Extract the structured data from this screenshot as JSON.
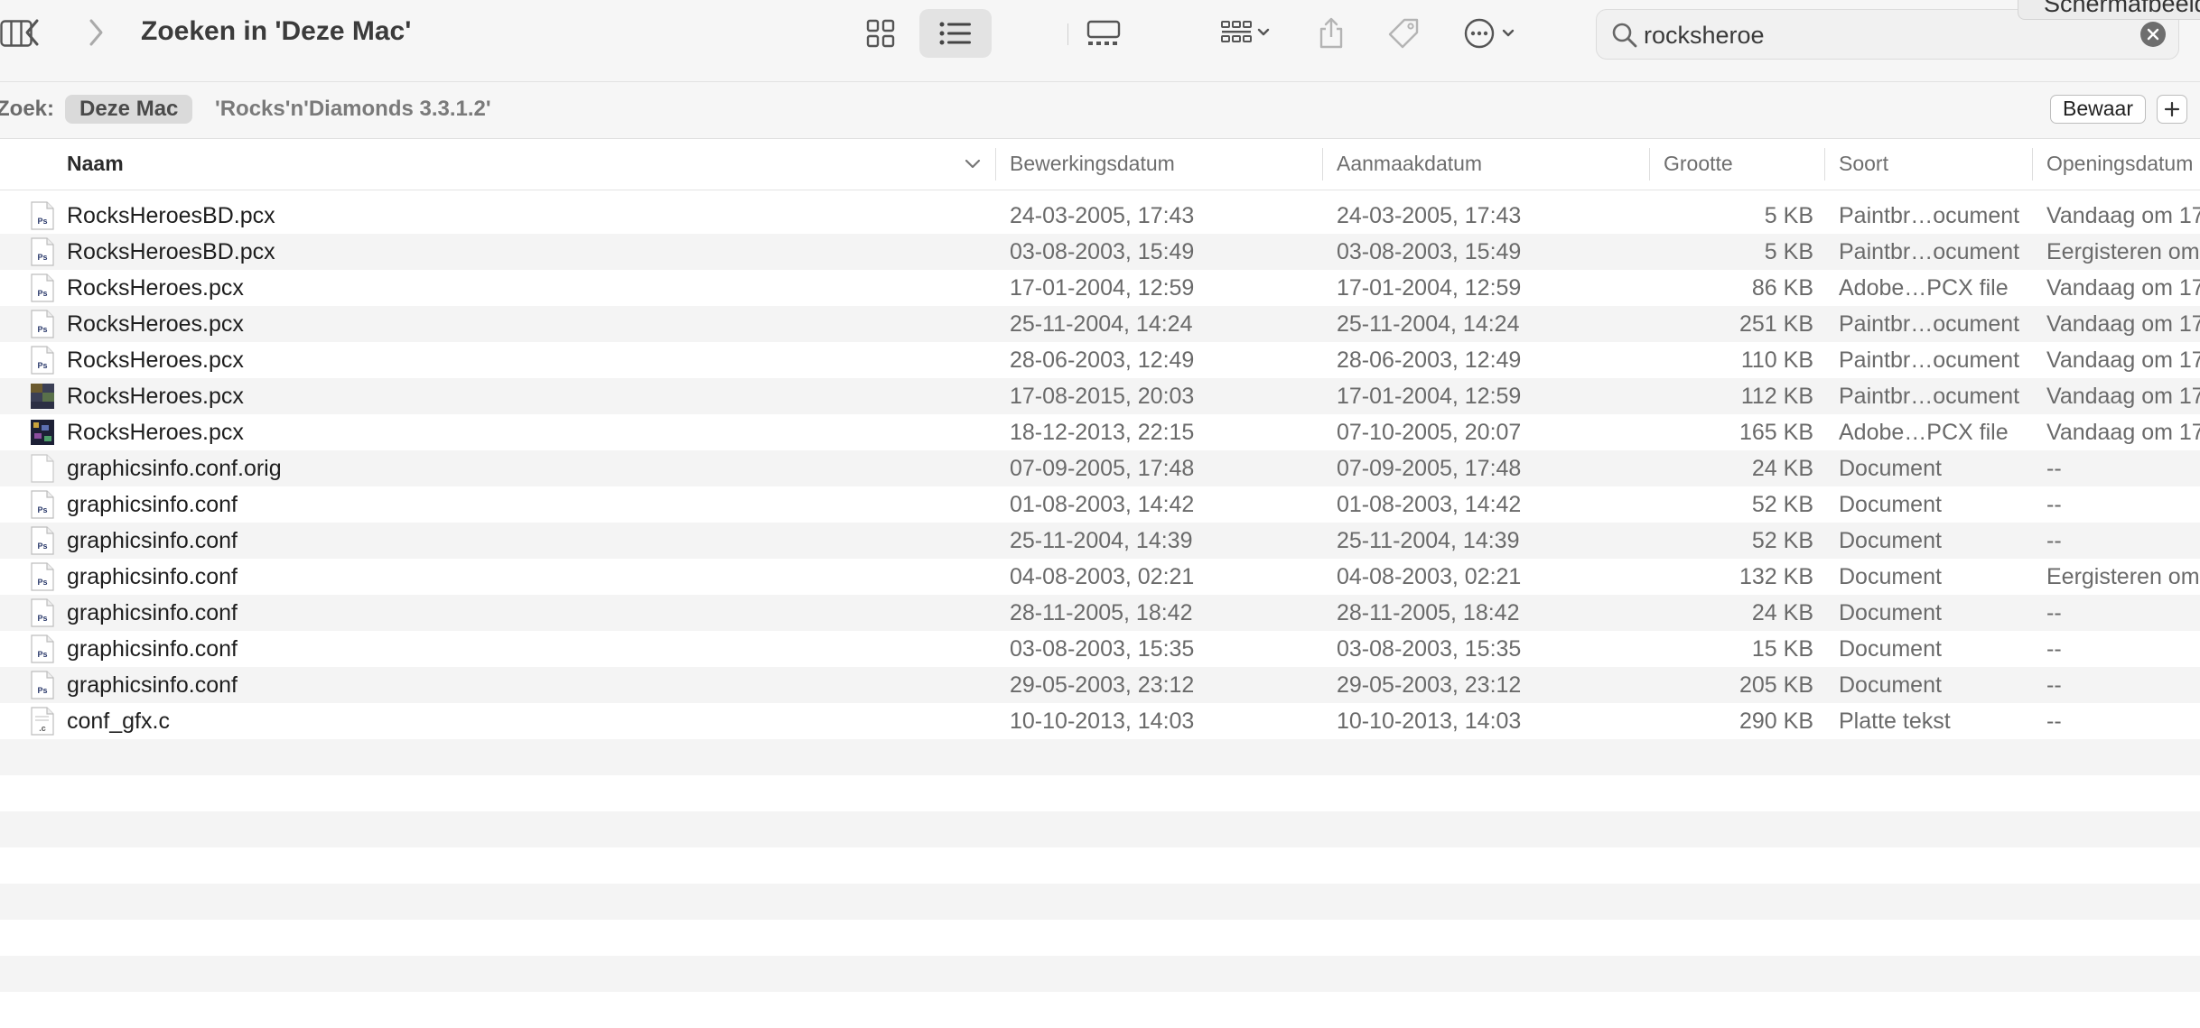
{
  "window": {
    "title": "Zoeken in 'Deze Mac'",
    "popup_text": "Schermafbeelding"
  },
  "toolbar": {
    "back_icon": "chevron-left-icon",
    "forward_icon": "chevron-right-icon",
    "view_modes": [
      "icon-view",
      "list-view",
      "column-view",
      "gallery-view"
    ],
    "active_view": "list-view",
    "group_icon": "group-grid-icon",
    "share_icon": "share-icon",
    "tag_icon": "tag-icon",
    "more_icon": "ellipsis-circle-icon"
  },
  "search": {
    "value": "rocksheroe",
    "icon": "magnifier-icon",
    "clear_icon": "clear-x-icon"
  },
  "scope": {
    "label": "Zoek:",
    "active": "Deze Mac",
    "other": "'Rocks'n'Diamonds 3.3.1.2'",
    "save_label": "Bewaar",
    "add_label": "+"
  },
  "columns": {
    "name": "Naam",
    "modified": "Bewerkingsdatum",
    "created": "Aanmaakdatum",
    "size": "Grootte",
    "kind": "Soort",
    "opened": "Openingsdatum"
  },
  "files": [
    {
      "name": "RocksHeroesBD.pcx",
      "modified": "24-03-2005, 17:43",
      "created": "24-03-2005, 17:43",
      "size": "5 KB",
      "kind": "Paintbr…ocument",
      "opened": "Vandaag om 17",
      "icon": "ps"
    },
    {
      "name": "RocksHeroesBD.pcx",
      "modified": "03-08-2003, 15:49",
      "created": "03-08-2003, 15:49",
      "size": "5 KB",
      "kind": "Paintbr…ocument",
      "opened": "Eergisteren om",
      "icon": "ps"
    },
    {
      "name": "RocksHeroes.pcx",
      "modified": "17-01-2004, 12:59",
      "created": "17-01-2004, 12:59",
      "size": "86 KB",
      "kind": "Adobe…PCX file",
      "opened": "Vandaag om 17",
      "icon": "ps"
    },
    {
      "name": "RocksHeroes.pcx",
      "modified": "25-11-2004, 14:24",
      "created": "25-11-2004, 14:24",
      "size": "251 KB",
      "kind": "Paintbr…ocument",
      "opened": "Vandaag om 17",
      "icon": "ps"
    },
    {
      "name": "RocksHeroes.pcx",
      "modified": "28-06-2003, 12:49",
      "created": "28-06-2003, 12:49",
      "size": "110 KB",
      "kind": "Paintbr…ocument",
      "opened": "Vandaag om 17",
      "icon": "ps"
    },
    {
      "name": "RocksHeroes.pcx",
      "modified": "17-08-2015, 20:03",
      "created": "17-01-2004, 12:59",
      "size": "112 KB",
      "kind": "Paintbr…ocument",
      "opened": "Vandaag om 17",
      "icon": "thumb"
    },
    {
      "name": "RocksHeroes.pcx",
      "modified": "18-12-2013, 22:15",
      "created": "07-10-2005, 20:07",
      "size": "165 KB",
      "kind": "Adobe…PCX file",
      "opened": "Vandaag om 17",
      "icon": "thumb2"
    },
    {
      "name": "graphicsinfo.conf.orig",
      "modified": "07-09-2005, 17:48",
      "created": "07-09-2005, 17:48",
      "size": "24 KB",
      "kind": "Document",
      "opened": "--",
      "icon": "blank"
    },
    {
      "name": "graphicsinfo.conf",
      "modified": "01-08-2003, 14:42",
      "created": "01-08-2003, 14:42",
      "size": "52 KB",
      "kind": "Document",
      "opened": "--",
      "icon": "ps"
    },
    {
      "name": "graphicsinfo.conf",
      "modified": "25-11-2004, 14:39",
      "created": "25-11-2004, 14:39",
      "size": "52 KB",
      "kind": "Document",
      "opened": "--",
      "icon": "ps"
    },
    {
      "name": "graphicsinfo.conf",
      "modified": "04-08-2003, 02:21",
      "created": "04-08-2003, 02:21",
      "size": "132 KB",
      "kind": "Document",
      "opened": "Eergisteren om",
      "icon": "ps"
    },
    {
      "name": "graphicsinfo.conf",
      "modified": "28-11-2005, 18:42",
      "created": "28-11-2005, 18:42",
      "size": "24 KB",
      "kind": "Document",
      "opened": "--",
      "icon": "ps"
    },
    {
      "name": "graphicsinfo.conf",
      "modified": "03-08-2003, 15:35",
      "created": "03-08-2003, 15:35",
      "size": "15 KB",
      "kind": "Document",
      "opened": "--",
      "icon": "ps"
    },
    {
      "name": "graphicsinfo.conf",
      "modified": "29-05-2003, 23:12",
      "created": "29-05-2003, 23:12",
      "size": "205 KB",
      "kind": "Document",
      "opened": "--",
      "icon": "ps"
    },
    {
      "name": "conf_gfx.c",
      "modified": "10-10-2013, 14:03",
      "created": "10-10-2013, 14:03",
      "size": "290 KB",
      "kind": "Platte tekst",
      "opened": "--",
      "icon": "c"
    }
  ],
  "colors": {
    "toolbar_bg": "#f6f6f6",
    "row_alt": "#f4f4f4",
    "ps_blue": "#2b3a6b"
  }
}
